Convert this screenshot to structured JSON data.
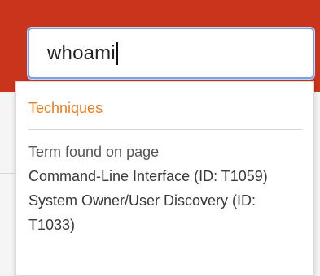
{
  "search": {
    "value": "whoami"
  },
  "dropdown": {
    "section_title": "Techniques",
    "note": "Term found on page",
    "results": [
      {
        "label": "Command-Line Interface (ID: T1059)"
      },
      {
        "label": "System Owner/User Discovery (ID: T1033)"
      }
    ]
  },
  "colors": {
    "header": "#c9341c",
    "section_title": "#e67e22",
    "input_border": "#7aa0e6"
  }
}
